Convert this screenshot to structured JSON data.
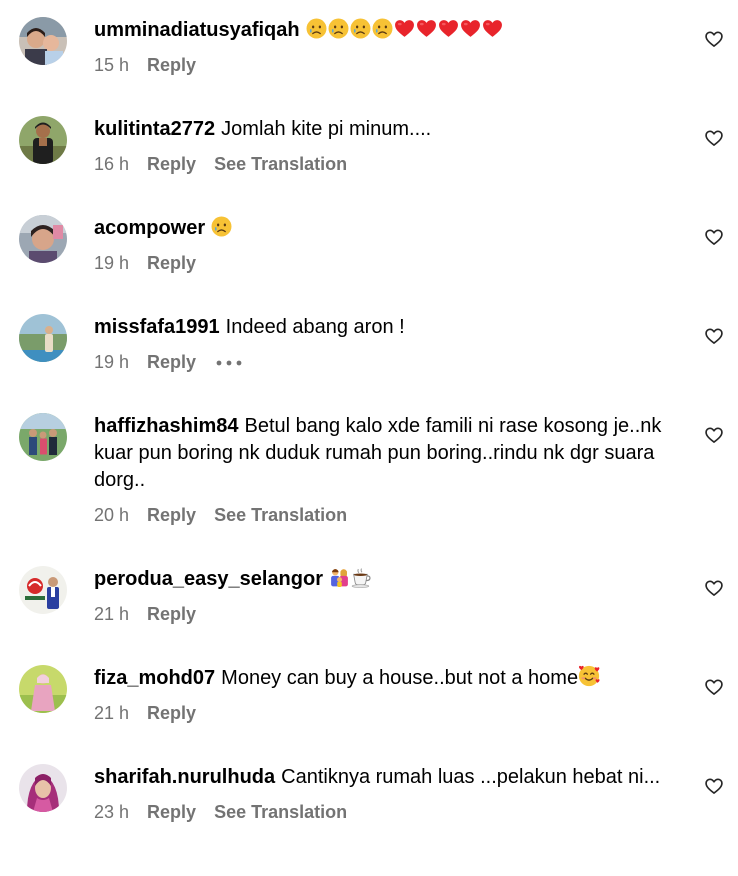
{
  "comments": [
    {
      "username": "umminadiatusyafiqah",
      "text": "",
      "emoji": [
        "sad-face-emoji",
        "sad-face-emoji",
        "sad-face-emoji",
        "sad-face-emoji",
        "red-heart-emoji",
        "red-heart-emoji",
        "red-heart-emoji",
        "red-heart-emoji",
        "red-heart-emoji"
      ],
      "time": "15 h",
      "reply": "Reply",
      "see_translation": ""
    },
    {
      "username": "kulitinta2772",
      "text": "Jomlah kite pi minum....",
      "emoji": [],
      "time": "16 h",
      "reply": "Reply",
      "see_translation": "See Translation"
    },
    {
      "username": "acompower",
      "text": "",
      "emoji": [
        "sad-face-emoji"
      ],
      "time": "19 h",
      "reply": "Reply",
      "see_translation": ""
    },
    {
      "username": "missfafa1991",
      "text": "Indeed abang aron !",
      "emoji": [],
      "time": "19 h",
      "reply": "Reply",
      "see_translation": ""
    },
    {
      "username": "haffizhashim84",
      "text": "Betul bang kalo xde famili ni rase kosong je..nk kuar pun boring nk duduk rumah pun boring..rindu nk dgr suara dorg..",
      "emoji": [],
      "time": "20 h",
      "reply": "Reply",
      "see_translation": "See Translation"
    },
    {
      "username": "perodua_easy_selangor",
      "text": "",
      "emoji": [
        "family-emoji",
        "coffee-emoji"
      ],
      "time": "21 h",
      "reply": "Reply",
      "see_translation": ""
    },
    {
      "username": "fiza_mohd07",
      "text": "Money can buy a house..but not a home",
      "emoji": [
        "smiling-face-with-hearts-emoji"
      ],
      "time": "21 h",
      "reply": "Reply",
      "see_translation": ""
    },
    {
      "username": "sharifah.nurulhuda",
      "text": "Cantiknya rumah luas ...pelakun hebat ni...",
      "emoji": [],
      "time": "23 h",
      "reply": "Reply",
      "see_translation": "See Translation"
    }
  ],
  "icons": {
    "like": "heart-outline-icon",
    "more": "more-options-icon"
  },
  "colors": {
    "text": "#000000",
    "meta": "#737373",
    "heart": "#e8242b",
    "emoji_yellow": "#f7c235"
  }
}
